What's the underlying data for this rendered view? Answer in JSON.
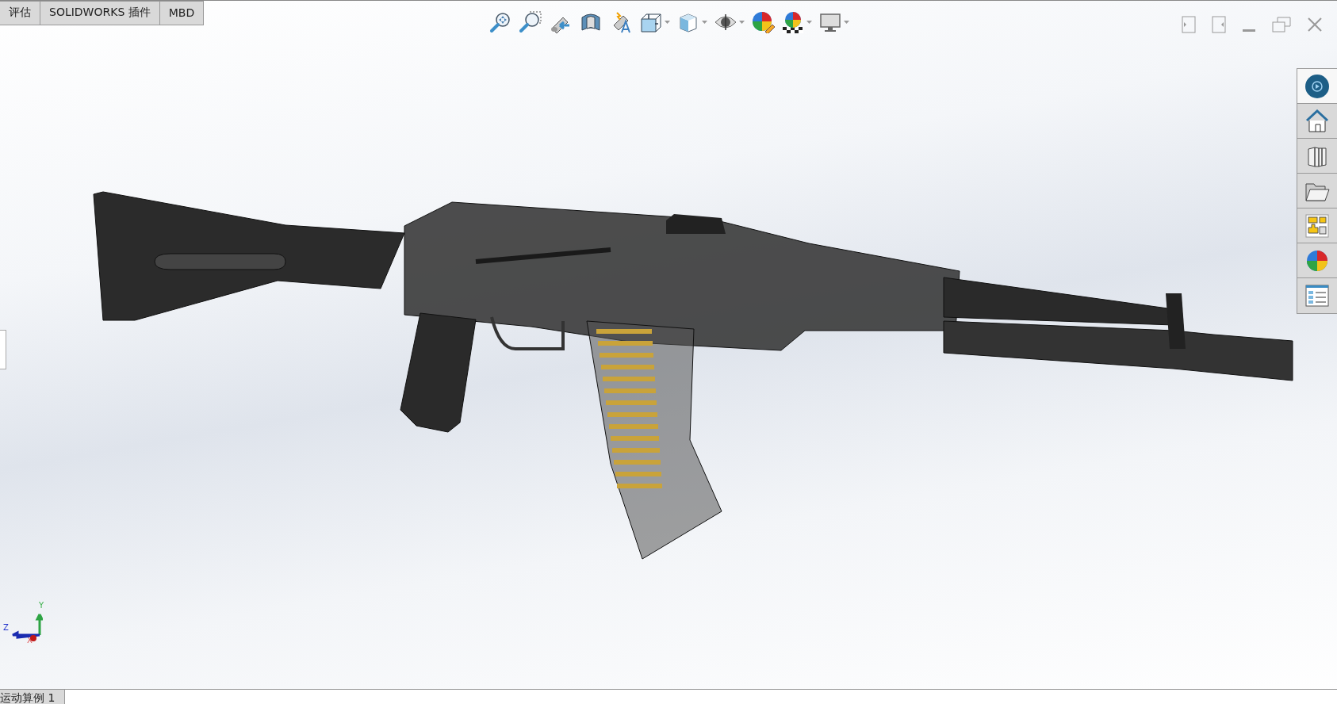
{
  "command_tabs": [
    {
      "label": "评估"
    },
    {
      "label": "SOLIDWORKS 插件"
    },
    {
      "label": "MBD"
    }
  ],
  "view_toolbar": [
    {
      "dropdown": false
    },
    {
      "dropdown": false
    },
    {
      "dropdown": false
    },
    {
      "dropdown": false
    },
    {
      "dropdown": false
    },
    {
      "dropdown": true
    },
    {
      "dropdown": true
    },
    {
      "dropdown": true
    },
    {
      "dropdown": false
    },
    {
      "dropdown": true
    },
    {
      "dropdown": true
    }
  ],
  "task_pane": [
    {
      "selected": true
    },
    {
      "selected": false
    },
    {
      "selected": false
    },
    {
      "selected": false
    },
    {
      "selected": false
    },
    {
      "selected": false
    },
    {
      "selected": false
    }
  ],
  "triad": {
    "y": "Y",
    "z": "Z",
    "x": "X"
  },
  "status_bar": {
    "tab": "运动算例 1"
  }
}
